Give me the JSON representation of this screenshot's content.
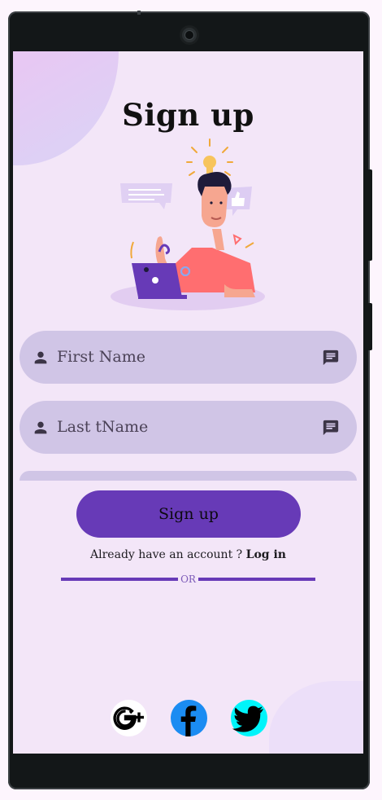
{
  "screen": {
    "title": "Sign up",
    "illustration_icon": "developer-with-laptop-illustration"
  },
  "form": {
    "first_name": {
      "placeholder": "First Name",
      "value": "",
      "leading_icon": "person-icon",
      "trailing_icon": "message-icon"
    },
    "last_name": {
      "placeholder": "Last tName",
      "value": "",
      "leading_icon": "person-icon",
      "trailing_icon": "message-icon"
    }
  },
  "actions": {
    "signup_label": "Sign up",
    "account_prompt": "Already have an account ? ",
    "login_label": "Log in",
    "or_label": "OR"
  },
  "social": [
    {
      "name": "google-plus",
      "icon": "google-plus-icon"
    },
    {
      "name": "facebook",
      "icon": "facebook-icon"
    },
    {
      "name": "twitter",
      "icon": "twitter-icon"
    }
  ],
  "colors": {
    "screen_bg": "#f3e6f8",
    "field_bg": "#d0c5e6",
    "primary": "#673ab7",
    "facebook": "#1b8cf2",
    "twitter": "#00f4fa"
  }
}
